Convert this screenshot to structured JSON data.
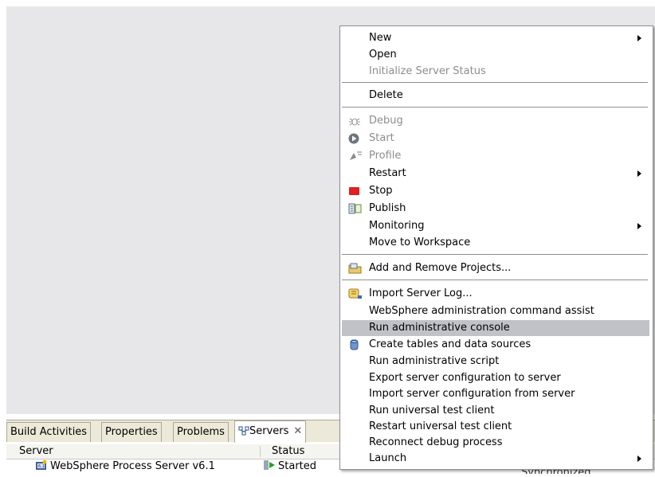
{
  "tabs": [
    {
      "label": "Build Activities"
    },
    {
      "label": "Properties"
    },
    {
      "label": "Problems"
    },
    {
      "label": "Servers",
      "active": true,
      "close": "✕"
    }
  ],
  "table": {
    "columns": [
      "Server",
      "Status"
    ],
    "row": {
      "server": "WebSphere Process Server v6.1",
      "status": "Started",
      "state": "Synchronized"
    }
  },
  "menu": {
    "items": [
      {
        "label": "New",
        "submenu": true
      },
      {
        "label": "Open"
      },
      {
        "label": "Initialize Server Status",
        "disabled": true
      },
      {
        "label": "Delete"
      },
      {
        "label": "Debug",
        "disabled": true,
        "icon": "debug-bug-icon"
      },
      {
        "label": "Start",
        "disabled": true,
        "icon": "start-icon"
      },
      {
        "label": "Profile",
        "disabled": true,
        "icon": "profile-icon"
      },
      {
        "label": "Restart",
        "submenu": true
      },
      {
        "label": "Stop",
        "icon": "stop-icon"
      },
      {
        "label": "Publish",
        "icon": "publish-icon"
      },
      {
        "label": "Monitoring",
        "submenu": true
      },
      {
        "label": "Move to Workspace"
      },
      {
        "label": "Add and Remove Projects...",
        "icon": "projects-icon"
      },
      {
        "label": "Import Server Log...",
        "icon": "server-log-icon"
      },
      {
        "label": "WebSphere administration command assist"
      },
      {
        "label": "Run administrative console",
        "highlight": true
      },
      {
        "label": "Create tables and data sources",
        "icon": "database-icon"
      },
      {
        "label": "Run administrative script"
      },
      {
        "label": "Export server configuration to server"
      },
      {
        "label": "Import server configuration from server"
      },
      {
        "label": "Run universal test client"
      },
      {
        "label": "Restart universal test client"
      },
      {
        "label": "Reconnect debug process"
      },
      {
        "label": "Launch",
        "submenu": true
      }
    ]
  },
  "colors": {
    "highlight": "#c1c2c8",
    "disabled_text": "#8d8d8d",
    "stop_red": "#e02020",
    "workspace_bg": "#e7e7ea"
  }
}
